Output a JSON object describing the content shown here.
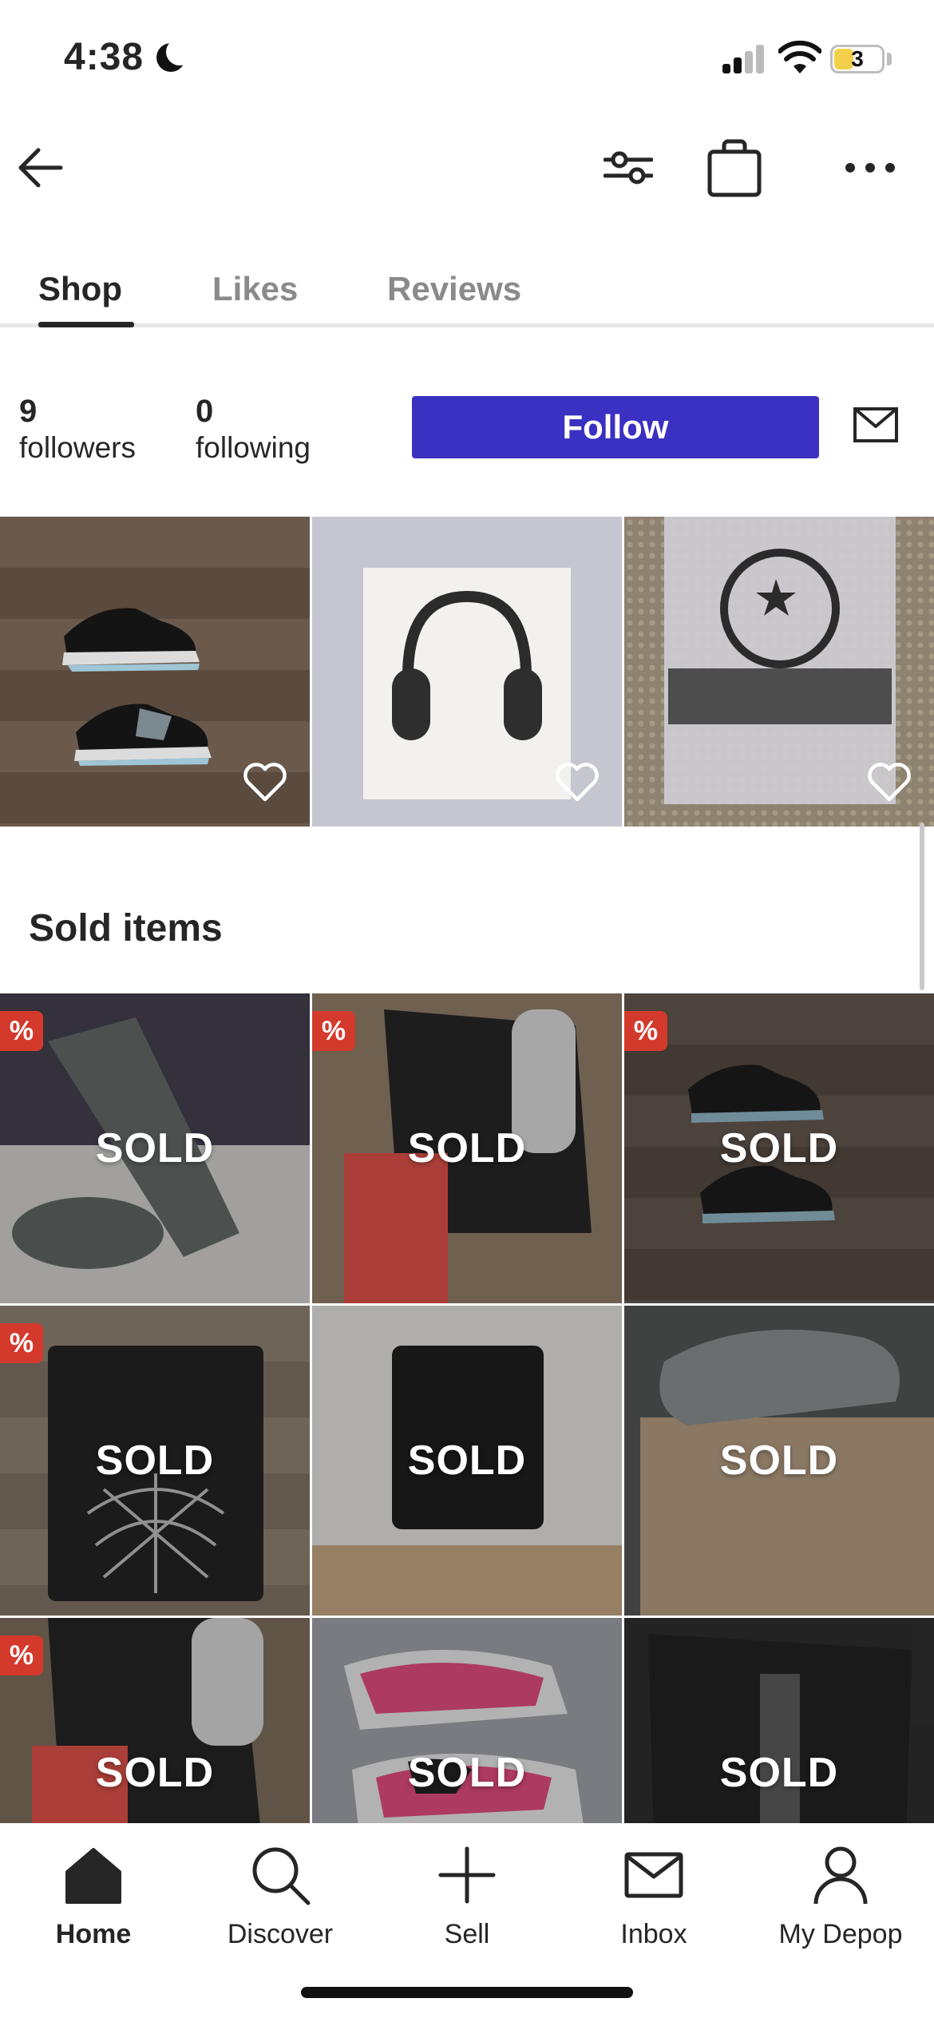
{
  "status_bar": {
    "time": "4:38",
    "battery": "3"
  },
  "nav": {
    "back_icon": "arrow-left-icon",
    "filter_icon": "sliders-icon",
    "bag_icon": "shopping-bag-icon",
    "more_icon": "ellipsis-icon"
  },
  "tabs": [
    {
      "label": "Shop",
      "active": true
    },
    {
      "label": "Likes",
      "active": false
    },
    {
      "label": "Reviews",
      "active": false
    }
  ],
  "profile": {
    "followers_count": "9",
    "followers_label": "followers",
    "following_count": "0",
    "following_label": "following",
    "follow_label": "Follow",
    "message_icon": "envelope-icon"
  },
  "shop_items": [
    {
      "subject": "black sneakers",
      "liked": false
    },
    {
      "subject": "headphones",
      "liked": false
    },
    {
      "subject": "bagged tee",
      "liked": false
    }
  ],
  "sold_section": {
    "title": "Sold items",
    "items": [
      {
        "label": "SOLD",
        "badge": "%",
        "subject": "slides"
      },
      {
        "label": "SOLD",
        "badge": "%",
        "subject": "sneakers box"
      },
      {
        "label": "SOLD",
        "badge": "%",
        "subject": "black sneakers"
      },
      {
        "label": "SOLD",
        "badge": "%",
        "subject": "black hoodie"
      },
      {
        "label": "SOLD",
        "badge": "",
        "subject": "black sweatshirt"
      },
      {
        "label": "SOLD",
        "badge": "",
        "subject": "grey slides"
      },
      {
        "label": "SOLD",
        "badge": "%",
        "subject": "sneakers"
      },
      {
        "label": "SOLD",
        "badge": "",
        "subject": "pink runners"
      },
      {
        "label": "SOLD",
        "badge": "",
        "subject": "tote bag"
      }
    ]
  },
  "bottom_nav": [
    {
      "label": "Home",
      "icon": "home-icon",
      "active": true
    },
    {
      "label": "Discover",
      "icon": "search-icon",
      "active": false
    },
    {
      "label": "Sell",
      "icon": "plus-icon",
      "active": false
    },
    {
      "label": "Inbox",
      "icon": "envelope-icon",
      "active": false
    },
    {
      "label": "My Depop",
      "icon": "user-icon",
      "active": false
    }
  ],
  "colors": {
    "accent": "#3a30c2",
    "badge": "#d43a2c",
    "text": "#262626",
    "muted": "#8a8a8a"
  }
}
